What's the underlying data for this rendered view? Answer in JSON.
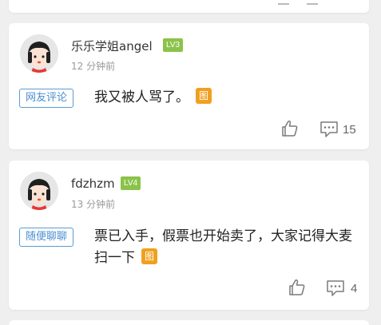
{
  "comments": [
    {
      "user": "乐乐学姐angel",
      "level": "LV3",
      "time": "12 分钟前",
      "tag": "网友评论",
      "text": "我又被人骂了。",
      "image_badge": "图",
      "comment_count": "15"
    },
    {
      "user": "fdzhzm",
      "level": "LV4",
      "time": "13 分钟前",
      "tag": "随便聊聊",
      "text": "票已入手，假票也开始卖了，大家记得大麦扫一下",
      "image_badge": "图",
      "comment_count": "4"
    }
  ],
  "colors": {
    "level_badge": "#8bc34a",
    "tag_border": "#5b9bd5",
    "image_badge": "#f0a020",
    "background": "#efefef"
  },
  "icons": {
    "like": "thumbs-up-icon",
    "comment": "comment-bubble-icon",
    "avatar": "cartoon-girl-avatar"
  }
}
